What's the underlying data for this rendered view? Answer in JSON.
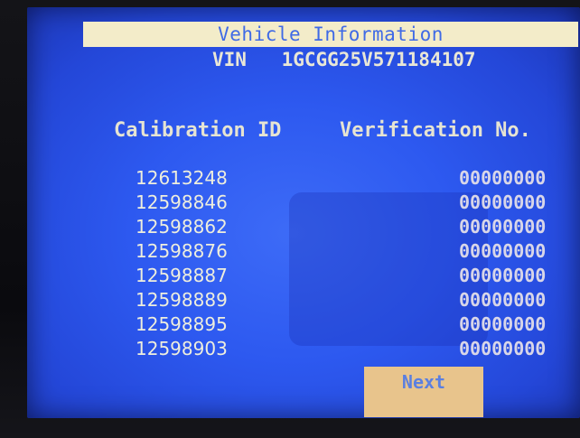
{
  "window": {
    "title": "Vehicle Information"
  },
  "vin": {
    "label": "VIN",
    "value": "1GCGG25V571184107"
  },
  "columns": {
    "calibration_header": "Calibration ID",
    "verification_header": "Verification No."
  },
  "rows": [
    {
      "calibration_id": "12613248",
      "verification_no": "00000000"
    },
    {
      "calibration_id": "12598846",
      "verification_no": "00000000"
    },
    {
      "calibration_id": "12598862",
      "verification_no": "00000000"
    },
    {
      "calibration_id": "12598876",
      "verification_no": "00000000"
    },
    {
      "calibration_id": "12598887",
      "verification_no": "00000000"
    },
    {
      "calibration_id": "12598889",
      "verification_no": "00000000"
    },
    {
      "calibration_id": "12598895",
      "verification_no": "00000000"
    },
    {
      "calibration_id": "12598903",
      "verification_no": "00000000"
    }
  ],
  "actions": {
    "next_label": "Next"
  },
  "colors": {
    "screen": "#2d59f0",
    "title_bar": "#f3ecc9",
    "button": "#e8c48c",
    "text": "#eeeedd"
  }
}
